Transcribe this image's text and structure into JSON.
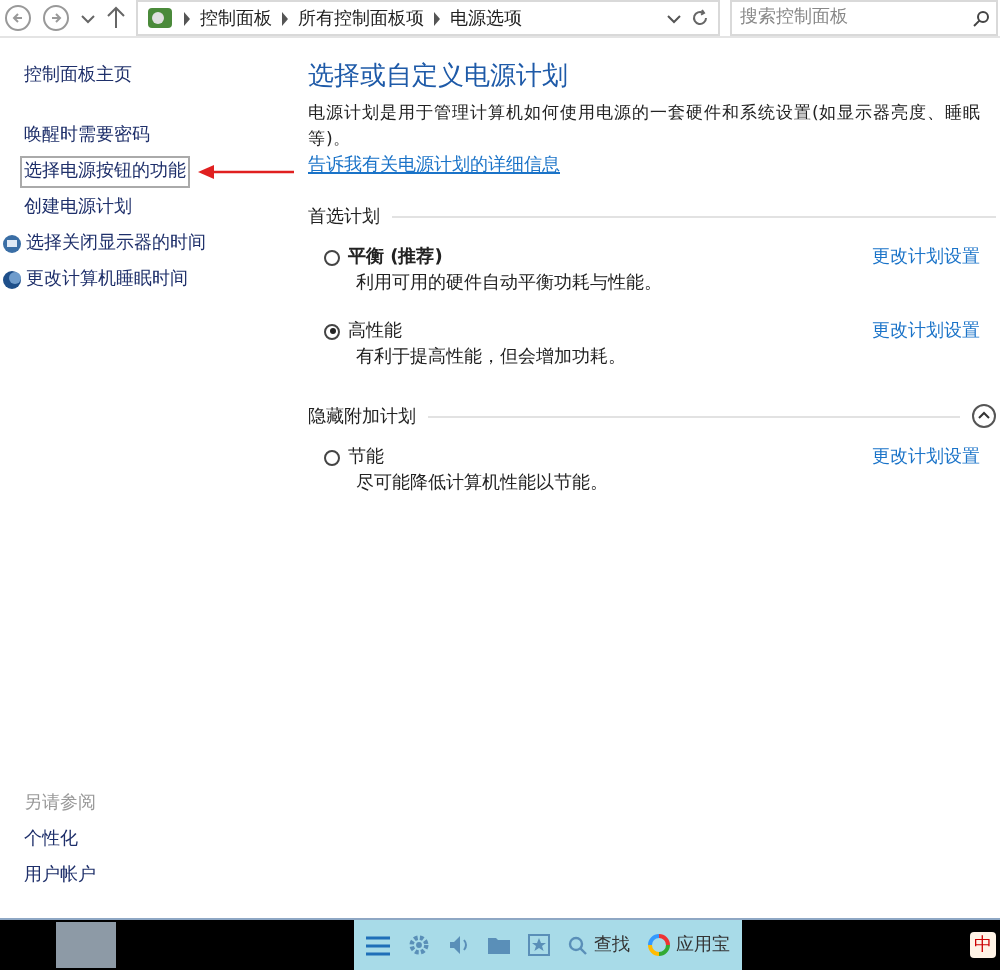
{
  "address_bar": {
    "breadcrumbs": [
      "控制面板",
      "所有控制面板项",
      "电源选项"
    ],
    "search": {
      "placeholder": "搜索控制面板"
    }
  },
  "sidebar": {
    "home": "控制面板主页",
    "items": [
      {
        "label": "唤醒时需要密码",
        "kind": "plain",
        "selected": false
      },
      {
        "label": "选择电源按钮的功能",
        "kind": "plain",
        "selected": true
      },
      {
        "label": "创建电源计划",
        "kind": "plain",
        "selected": false
      },
      {
        "label": "选择关闭显示器的时间",
        "kind": "display",
        "selected": false
      },
      {
        "label": "更改计算机睡眠时间",
        "kind": "sleep",
        "selected": false
      }
    ],
    "see_also": {
      "heading": "另请参阅",
      "links": [
        "个性化",
        "用户帐户"
      ]
    }
  },
  "main": {
    "title": "选择或自定义电源计划",
    "description": "电源计划是用于管理计算机如何使用电源的一套硬件和系统设置(如显示器亮度、睡眠等)。",
    "info_link": "告诉我有关电源计划的详细信息",
    "groups": [
      {
        "heading": "首选计划",
        "plans": [
          {
            "name": "平衡 (推荐)",
            "bold": true,
            "description": "利用可用的硬件自动平衡功耗与性能。",
            "selected": false,
            "link": "更改计划设置"
          },
          {
            "name": "高性能",
            "bold": false,
            "description": "有利于提高性能，但会增加功耗。",
            "selected": true,
            "link": "更改计划设置"
          }
        ]
      },
      {
        "heading": "隐藏附加计划",
        "plans": [
          {
            "name": "节能",
            "bold": false,
            "description": "尽可能降低计算机性能以节能。",
            "selected": false,
            "link": "更改计划设置"
          }
        ]
      }
    ]
  },
  "taskbar": {
    "search_label": "查找",
    "app_label": "应用宝",
    "ime": "中"
  }
}
